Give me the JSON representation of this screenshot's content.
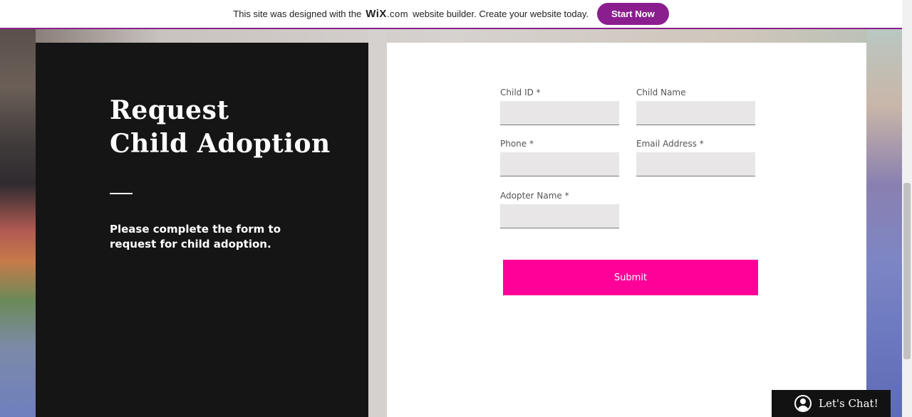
{
  "banner": {
    "prefix": "This site was designed with the",
    "logo_main": "WiX",
    "logo_suffix": ".com",
    "suffix": "website builder. Create your website today.",
    "cta": "Start Now"
  },
  "hero": {
    "title_line1": "Request",
    "title_line2": "Child Adoption",
    "subtitle": "Please complete the form to request for child adoption."
  },
  "form": {
    "fields": [
      {
        "label": "Child ID *",
        "value": ""
      },
      {
        "label": "Child Name",
        "value": ""
      },
      {
        "label": "Phone *",
        "value": ""
      },
      {
        "label": "Email Address *",
        "value": ""
      },
      {
        "label": "Adopter Name *",
        "value": ""
      }
    ],
    "submit_label": "Submit"
  },
  "chat": {
    "label": "Let's Chat!",
    "icon": "user-avatar-icon"
  },
  "colors": {
    "accent_pink": "#ff0099",
    "wix_purple": "#8b1e8f",
    "panel_dark": "#151515"
  }
}
